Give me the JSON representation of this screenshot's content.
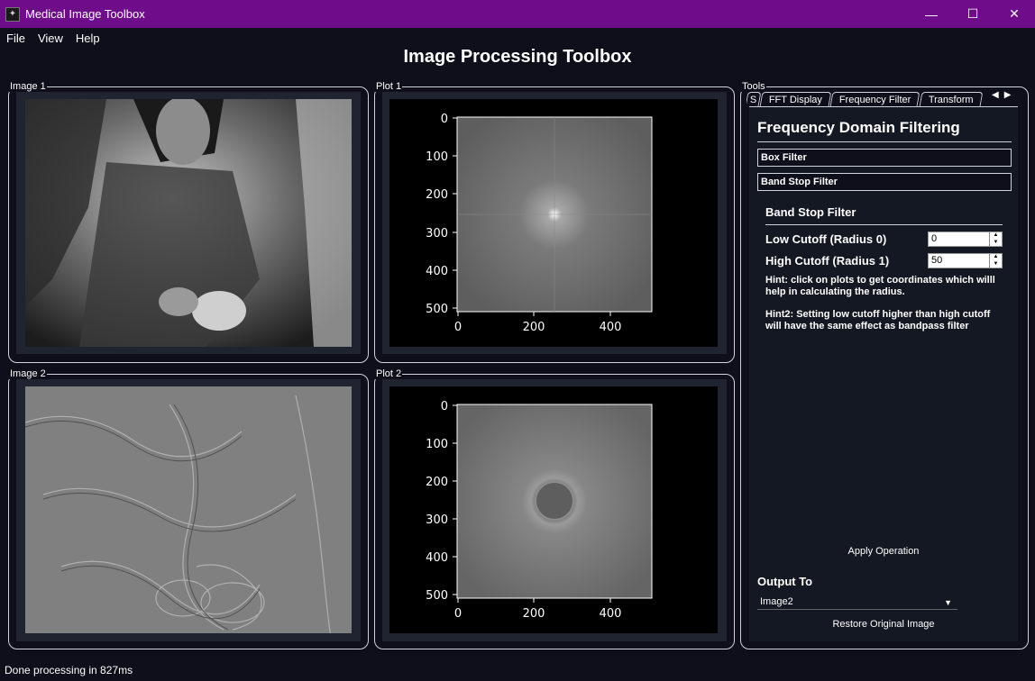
{
  "window": {
    "title": "Medical Image Toolbox",
    "minimize": "—",
    "maximize": "☐",
    "close": "✕"
  },
  "menu": [
    "File",
    "View",
    "Help"
  ],
  "page_title": "Image Processing Toolbox",
  "panels": {
    "image1": "Image 1",
    "image2": "Image 2",
    "plot1": "Plot 1",
    "plot2": "Plot 2",
    "tools": "Tools"
  },
  "plots": {
    "x_ticks": [
      "0",
      "200",
      "400"
    ],
    "y_ticks": [
      "0",
      "100",
      "200",
      "300",
      "400",
      "500"
    ]
  },
  "tabs": [
    "S",
    "FFT Display",
    "Frequency Filter",
    "Transform"
  ],
  "active_tab": "Frequency Filter",
  "tool": {
    "heading": "Frequency Domain Filtering",
    "box_filter": "Box Filter",
    "band_stop_filter": "Band Stop Filter",
    "sub_heading": "Band Stop Filter",
    "low_label": "Low Cutoff (Radius 0)",
    "low_value": "0",
    "high_label": "High Cutoff (Radius 1)",
    "high_value": "50",
    "hint1": "Hint: click on plots to get coordinates which willl help in calculating the radius.",
    "hint2": "Hint2: Setting low cutoff higher than high cutoff will have the same effect as bandpass filter",
    "apply": "Apply Operation",
    "output_label": "Output To",
    "output_value": "Image2",
    "restore": "Restore Original Image"
  },
  "status": "Done processing in 827ms",
  "colors": {
    "titlebar": "#6e0c8a",
    "background": "#0e0f1a"
  }
}
